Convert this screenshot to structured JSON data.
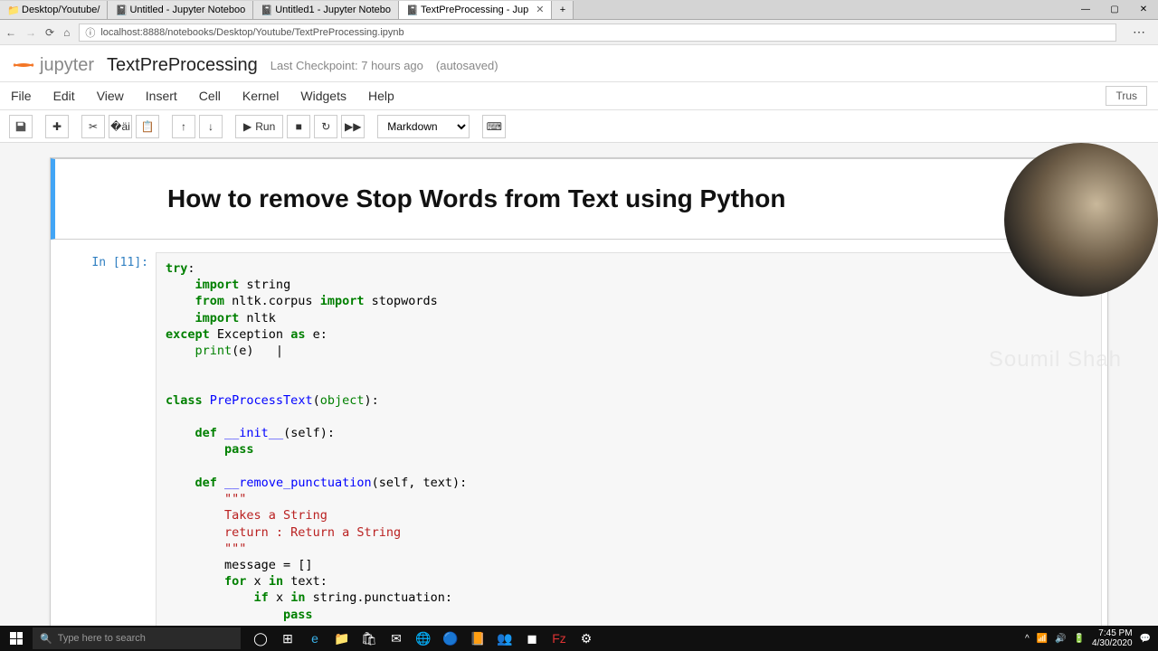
{
  "browser": {
    "tabs": [
      {
        "label": "Desktop/Youtube/"
      },
      {
        "label": "Untitled - Jupyter Noteboo"
      },
      {
        "label": "Untitled1 - Jupyter Notebo"
      },
      {
        "label": "TextPreProcessing - Jup",
        "active": true
      }
    ],
    "url": "localhost:8888/notebooks/Desktop/Youtube/TextPreProcessing.ipynb"
  },
  "header": {
    "logo_text": "jupyter",
    "title": "TextPreProcessing",
    "checkpoint": "Last Checkpoint: 7 hours ago",
    "autosaved": "(autosaved)"
  },
  "menu": {
    "items": [
      "File",
      "Edit",
      "View",
      "Insert",
      "Cell",
      "Kernel",
      "Widgets",
      "Help"
    ],
    "trusted": "Trus"
  },
  "toolbar": {
    "run_label": "Run",
    "cell_type": "Markdown"
  },
  "notebook": {
    "heading": "How to remove Stop Words from Text using Python",
    "prompt": "In [11]:",
    "code_lines": [
      [
        [
          "kw",
          "try"
        ],
        [
          "",
          ":"
        ]
      ],
      [
        [
          "",
          "    "
        ],
        [
          "kw",
          "import"
        ],
        [
          "",
          " string"
        ]
      ],
      [
        [
          "",
          "    "
        ],
        [
          "kw",
          "from"
        ],
        [
          "",
          " nltk.corpus "
        ],
        [
          "kw",
          "import"
        ],
        [
          "",
          " stopwords"
        ]
      ],
      [
        [
          "",
          "    "
        ],
        [
          "kw",
          "import"
        ],
        [
          "",
          " nltk"
        ]
      ],
      [
        [
          "kw",
          "except"
        ],
        [
          "",
          " Exception "
        ],
        [
          "kw",
          "as"
        ],
        [
          "",
          " e:"
        ]
      ],
      [
        [
          "",
          "    "
        ],
        [
          "bn",
          "print"
        ],
        [
          "",
          "(e)   |"
        ]
      ],
      [
        [
          "",
          ""
        ]
      ],
      [
        [
          "",
          ""
        ]
      ],
      [
        [
          "kw",
          "class"
        ],
        [
          "",
          " "
        ],
        [
          "cls",
          "PreProcessText"
        ],
        [
          "",
          "("
        ],
        [
          "bn",
          "object"
        ],
        [
          "",
          "):"
        ]
      ],
      [
        [
          "",
          ""
        ]
      ],
      [
        [
          "",
          "    "
        ],
        [
          "kw",
          "def"
        ],
        [
          "",
          " "
        ],
        [
          "nf",
          "__init__"
        ],
        [
          "",
          "(self):"
        ]
      ],
      [
        [
          "",
          "        "
        ],
        [
          "kw",
          "pass"
        ]
      ],
      [
        [
          "",
          ""
        ]
      ],
      [
        [
          "",
          "    "
        ],
        [
          "kw",
          "def"
        ],
        [
          "",
          " "
        ],
        [
          "nf",
          "__remove_punctuation"
        ],
        [
          "",
          "(self, text):"
        ]
      ],
      [
        [
          "",
          "        "
        ],
        [
          "str",
          "\"\"\""
        ]
      ],
      [
        [
          "",
          "        "
        ],
        [
          "str",
          "Takes a String"
        ]
      ],
      [
        [
          "",
          "        "
        ],
        [
          "str",
          "return : Return a String"
        ]
      ],
      [
        [
          "",
          "        "
        ],
        [
          "str",
          "\"\"\""
        ]
      ],
      [
        [
          "",
          "        message = []"
        ]
      ],
      [
        [
          "",
          "        "
        ],
        [
          "kw",
          "for"
        ],
        [
          "",
          " x "
        ],
        [
          "kw",
          "in"
        ],
        [
          "",
          " text:"
        ]
      ],
      [
        [
          "",
          "            "
        ],
        [
          "kw",
          "if"
        ],
        [
          "",
          " x "
        ],
        [
          "kw",
          "in"
        ],
        [
          "",
          " string.punctuation:"
        ]
      ],
      [
        [
          "",
          "                "
        ],
        [
          "kw",
          "pass"
        ]
      ]
    ]
  },
  "overlay": {
    "name": "Soumil Shah"
  },
  "taskbar": {
    "search_placeholder": "Type here to search",
    "time": "7:45 PM",
    "date": "4/30/2020"
  }
}
